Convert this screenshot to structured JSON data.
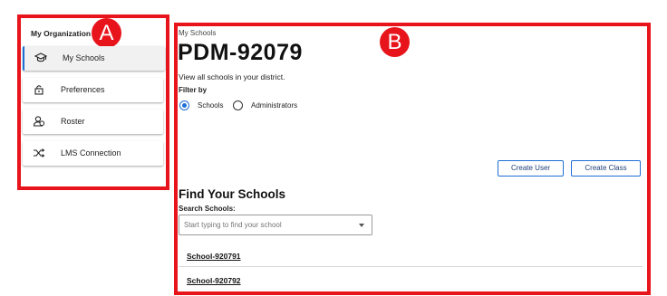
{
  "sidebar": {
    "title": "My Organization",
    "items": [
      {
        "label": "My Schools",
        "icon": "graduation-cap-icon",
        "active": true
      },
      {
        "label": "Preferences",
        "icon": "lock-icon",
        "active": false
      },
      {
        "label": "Roster",
        "icon": "users-icon",
        "active": false
      },
      {
        "label": "LMS Connection",
        "icon": "shuffle-icon",
        "active": false
      }
    ]
  },
  "badges": {
    "a": "A",
    "b": "B"
  },
  "main": {
    "breadcrumb": "My Schools",
    "title": "PDM-92079",
    "description": "View all schools in your district.",
    "filter_label": "Filter by",
    "filter_options": [
      {
        "label": "Schools",
        "selected": true
      },
      {
        "label": "Administrators",
        "selected": false
      }
    ],
    "buttons": {
      "create_user": "Create User",
      "create_class": "Create Class"
    },
    "find_title": "Find Your Schools",
    "search_label": "Search Schools:",
    "search_placeholder": "Start typing to find your school",
    "schools": [
      "School-920791",
      "School-920792"
    ]
  },
  "colors": {
    "highlight": "#e8141c",
    "accent": "#1f6fd6"
  }
}
